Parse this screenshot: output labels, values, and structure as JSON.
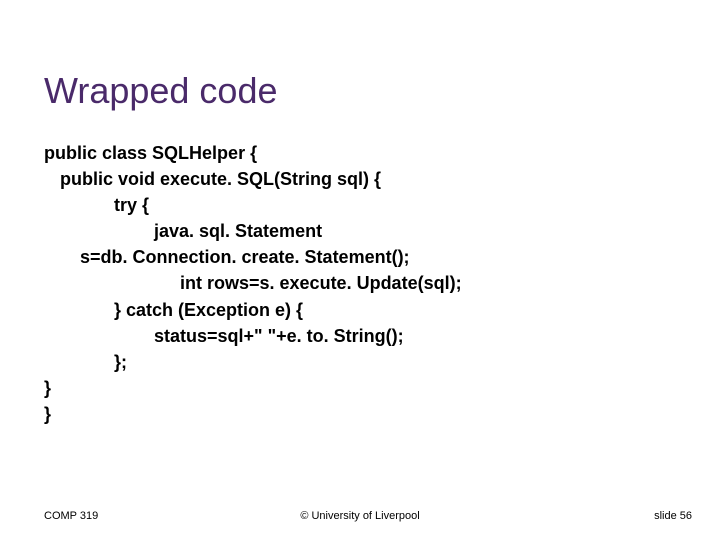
{
  "title": "Wrapped code",
  "code": {
    "l1": "public class SQLHelper {",
    "l2": "public void execute. SQL(String sql) {",
    "l3": "try {",
    "l4": "java. sql. Statement",
    "l5": "s=db. Connection. create. Statement();",
    "l6": "int rows=s. execute. Update(sql);",
    "l7": "} catch (Exception e) {",
    "l8": "status=sql+\" \"+e. to. String();",
    "l9": "};",
    "l10": "}",
    "l11": "}"
  },
  "footer": {
    "left": "COMP 319",
    "center": "© University of Liverpool",
    "right": "slide  56"
  }
}
